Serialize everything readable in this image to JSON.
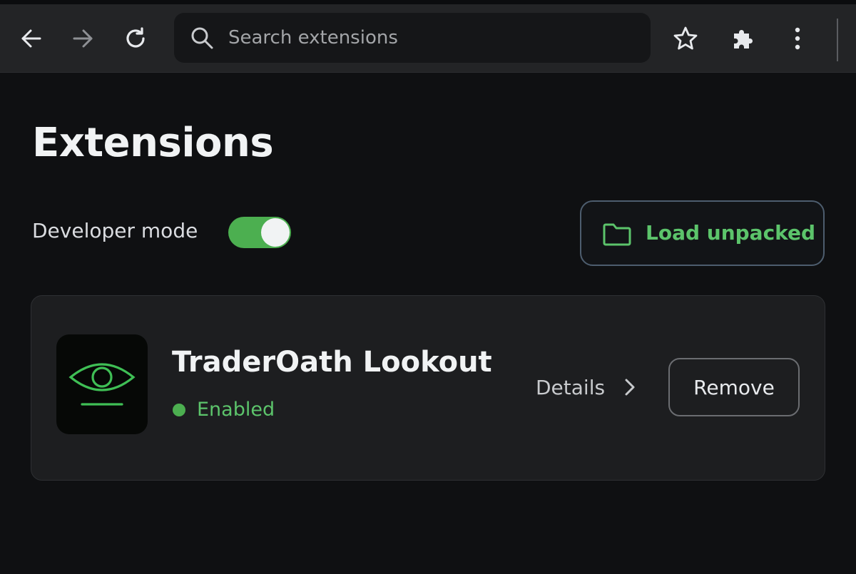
{
  "toolbar": {
    "back_icon": "arrow-left-icon",
    "forward_icon": "arrow-right-icon",
    "reload_icon": "reload-icon",
    "search_placeholder": "Search extensions",
    "search_value": "",
    "bookmark_icon": "star-icon",
    "extensions_icon": "puzzle-icon",
    "menu_icon": "more-vertical-icon"
  },
  "page": {
    "title": "Extensions",
    "developer_mode_label": "Developer mode",
    "developer_mode_enabled": true,
    "load_unpacked_label": "Load unpacked"
  },
  "extension": {
    "name": "TraderOath Lookout",
    "status": "Enabled",
    "details_label": "Details",
    "remove_label": "Remove",
    "icon": "eye-icon"
  },
  "colors": {
    "accent_green": "#4caf50",
    "text_green": "#5cc46b",
    "background": "#0f1012",
    "toolbar": "#232426",
    "card": "#1d1e20"
  }
}
